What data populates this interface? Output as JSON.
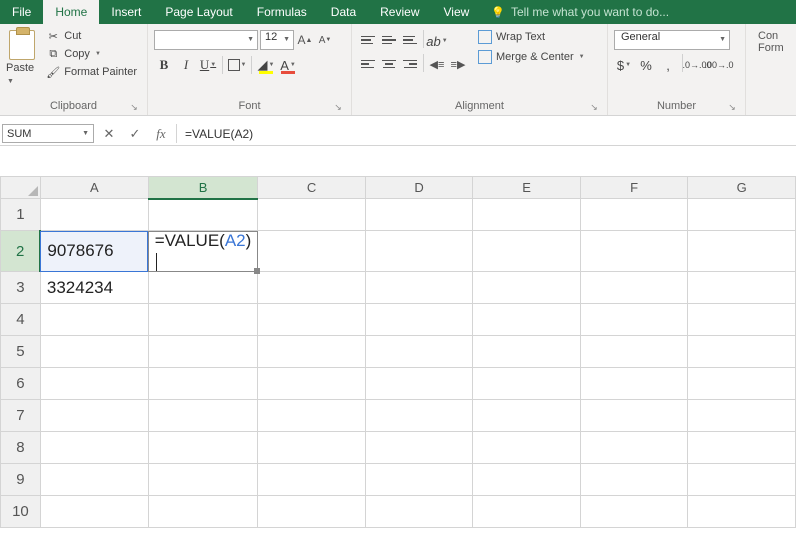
{
  "tabs": {
    "file": "File",
    "home": "Home",
    "insert": "Insert",
    "page_layout": "Page Layout",
    "formulas": "Formulas",
    "data": "Data",
    "review": "Review",
    "view": "View",
    "tell_me": "Tell me what you want to do..."
  },
  "clipboard": {
    "paste": "Paste",
    "cut": "Cut",
    "copy": "Copy",
    "format_painter": "Format Painter",
    "group": "Clipboard"
  },
  "font": {
    "name": "",
    "size": "12",
    "group": "Font"
  },
  "alignment": {
    "wrap": "Wrap Text",
    "merge": "Merge & Center",
    "group": "Alignment"
  },
  "number": {
    "format": "General",
    "group": "Number"
  },
  "cells": {
    "cond": "Con",
    "form": "Form"
  },
  "name_box": "SUM",
  "formula_bar": "=VALUE(A2)",
  "columns": [
    "A",
    "B",
    "C",
    "D",
    "E",
    "F",
    "G"
  ],
  "rows": [
    "1",
    "2",
    "3",
    "4",
    "5",
    "6",
    "7",
    "8",
    "9",
    "10"
  ],
  "cells_data": {
    "A2": "9078676",
    "A3": "3324234",
    "B2_pre": "=VALUE(",
    "B2_ref": "A2",
    "B2_post": ")"
  },
  "active": {
    "col": "B",
    "row": "2",
    "ref_col": "A",
    "ref_row": "2"
  }
}
